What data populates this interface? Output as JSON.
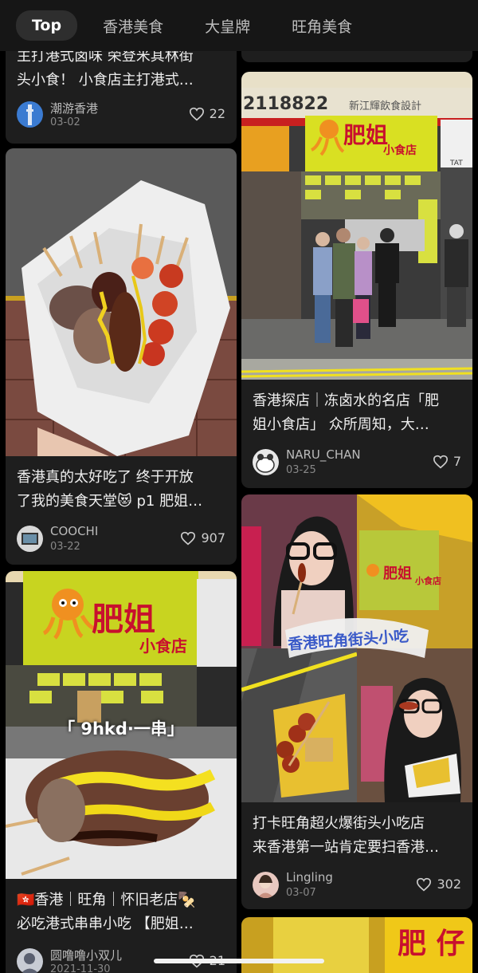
{
  "tabs": [
    "Top",
    "香港美食",
    "大皇牌",
    "旺角美食"
  ],
  "cards": {
    "c1": {
      "caption_lines": [
        "主打港式卤味 荣登米其林街",
        "头小食！ 小食店主打港式…"
      ],
      "author": "潮游香港",
      "date": "03-02",
      "likes": "22"
    },
    "c2": {
      "caption_lines": [
        "香港真的太好吃了 终于开放",
        "了我的美食天堂😻 p1 肥姐…"
      ],
      "author": "COOCHI",
      "date": "03-22",
      "likes": "907"
    },
    "c3": {
      "overlay": "「 9hkd·一串」",
      "sign_main": "肥姐",
      "sign_sub": "小食店",
      "caption_lines": [
        "🇭🇰香港｜旺角｜怀旧老店🍢",
        "必吃港式串串小吃 【肥姐…"
      ],
      "author": "圆噜噜小双儿",
      "date": "2021-11-30",
      "likes": "21"
    },
    "c4": {
      "caption_lines": [
        "香港探店｜冻卤水的名店「肥",
        "姐小食店」 众所周知，大…"
      ],
      "author": "NARU_CHAN",
      "date": "03-25",
      "likes": "7",
      "sign_main": "肥姐",
      "sign_sub": "小食店",
      "phone": "2118822",
      "shop_name": "新江輝飲食設計",
      "side_sign": "TAT"
    },
    "c5": {
      "banner": "香港旺角街头小吃",
      "sign_main": "肥姐",
      "sign_sub": "小食店",
      "caption_lines": [
        "打卡旺角超火爆街头小吃店",
        "来香港第一站肯定要扫香港…"
      ],
      "author": "Lingling",
      "date": "03-07",
      "likes": "302"
    },
    "c6": {
      "sign": "肥 仔"
    }
  },
  "colors": {
    "accent_yellow": "#d9e022",
    "bg": "#000000",
    "card": "#1e1e1e"
  }
}
